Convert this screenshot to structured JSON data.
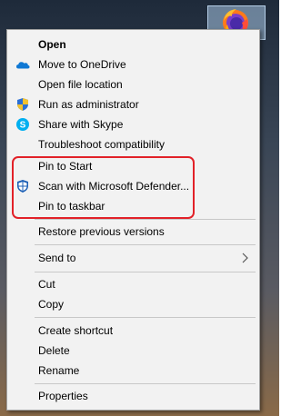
{
  "menu": {
    "items": [
      {
        "id": "open",
        "label": "Open",
        "icon": "",
        "bold": true
      },
      {
        "id": "move-to-onedrive",
        "label": "Move to OneDrive",
        "icon": "onedrive-icon"
      },
      {
        "id": "open-file-location",
        "label": "Open file location",
        "icon": ""
      },
      {
        "id": "run-as-administrator",
        "label": "Run as administrator",
        "icon": "uac-shield-icon"
      },
      {
        "id": "share-with-skype",
        "label": "Share with Skype",
        "icon": "skype-icon"
      },
      {
        "id": "troubleshoot-compatibility",
        "label": "Troubleshoot compatibility",
        "icon": ""
      },
      {
        "id": "pin-to-start",
        "label": "Pin to Start",
        "icon": ""
      },
      {
        "id": "scan-with-defender",
        "label": "Scan with Microsoft Defender...",
        "icon": "defender-icon"
      },
      {
        "id": "pin-to-taskbar",
        "label": "Pin to taskbar",
        "icon": ""
      },
      {
        "id": "restore-previous-versions",
        "label": "Restore previous versions",
        "icon": ""
      },
      {
        "id": "send-to",
        "label": "Send to",
        "icon": "",
        "submenu": true
      },
      {
        "id": "cut",
        "label": "Cut",
        "icon": ""
      },
      {
        "id": "copy",
        "label": "Copy",
        "icon": ""
      },
      {
        "id": "create-shortcut",
        "label": "Create shortcut",
        "icon": ""
      },
      {
        "id": "delete",
        "label": "Delete",
        "icon": ""
      },
      {
        "id": "rename",
        "label": "Rename",
        "icon": ""
      },
      {
        "id": "properties",
        "label": "Properties",
        "icon": ""
      }
    ]
  },
  "highlight": {
    "color": "#e22128"
  },
  "desktop": {
    "icon": "firefox-icon"
  }
}
